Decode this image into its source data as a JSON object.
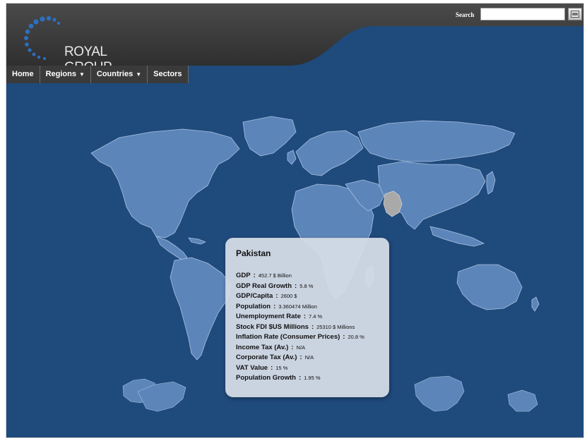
{
  "header": {
    "logo_text": "ROYAL GROUP",
    "search_label": "Search",
    "search_value": ""
  },
  "nav": [
    {
      "label": "Home",
      "has_menu": false
    },
    {
      "label": "Regions",
      "has_menu": true
    },
    {
      "label": "Countries",
      "has_menu": true
    },
    {
      "label": "Sectors",
      "has_menu": false
    }
  ],
  "map": {
    "selected_country": "Pakistan",
    "ocean_color": "#1f4a7c",
    "land_color": "#5c86ba",
    "highlight_color": "#a9a9a9"
  },
  "info": {
    "title": "Pakistan",
    "rows": [
      {
        "label": "GDP",
        "value": "452.7 $ Billion"
      },
      {
        "label": "GDP Real Growth",
        "value": "5.8 %"
      },
      {
        "label": "GDP/Capita",
        "value": "2600 $"
      },
      {
        "label": "Population",
        "value": "3.360474 Million"
      },
      {
        "label": "Unemployment Rate",
        "value": "7.4 %"
      },
      {
        "label": "Stock FDI $US Millions",
        "value": "25310 $ Millions"
      },
      {
        "label": "Inflation Rate (Consumer Prices)",
        "value": "20.8 %"
      },
      {
        "label": "Income Tax (Av.)",
        "value": "N/A"
      },
      {
        "label": "Corporate Tax (Av.)",
        "value": "N/A"
      },
      {
        "label": "VAT Value",
        "value": "15 %"
      },
      {
        "label": "Population Growth",
        "value": "1.95 %"
      }
    ]
  }
}
